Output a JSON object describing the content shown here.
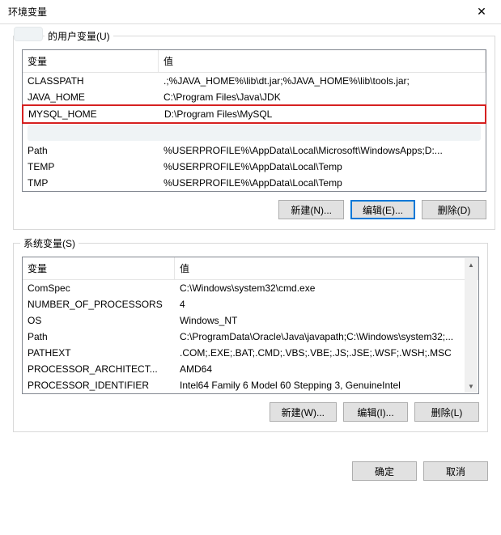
{
  "window": {
    "title": "环境变量",
    "close_icon": "✕"
  },
  "user_section": {
    "label_suffix": "的用户变量(U)",
    "headers": {
      "variable": "变量",
      "value": "值"
    },
    "rows": [
      {
        "var": "CLASSPATH",
        "val": ".;%JAVA_HOME%\\lib\\dt.jar;%JAVA_HOME%\\lib\\tools.jar;"
      },
      {
        "var": "JAVA_HOME",
        "val": "C:\\Program Files\\Java\\JDK"
      },
      {
        "var": "MYSQL_HOME",
        "val": "D:\\Program Files\\MySQL"
      },
      {
        "var": "Path",
        "val": "%USERPROFILE%\\AppData\\Local\\Microsoft\\WindowsApps;D:..."
      },
      {
        "var": "TEMP",
        "val": "%USERPROFILE%\\AppData\\Local\\Temp"
      },
      {
        "var": "TMP",
        "val": "%USERPROFILE%\\AppData\\Local\\Temp"
      }
    ],
    "buttons": {
      "new": "新建(N)...",
      "edit": "编辑(E)...",
      "delete": "删除(D)"
    }
  },
  "system_section": {
    "label": "系统变量(S)",
    "headers": {
      "variable": "变量",
      "value": "值"
    },
    "rows": [
      {
        "var": "ComSpec",
        "val": "C:\\Windows\\system32\\cmd.exe"
      },
      {
        "var": "NUMBER_OF_PROCESSORS",
        "val": "4"
      },
      {
        "var": "OS",
        "val": "Windows_NT"
      },
      {
        "var": "Path",
        "val": "C:\\ProgramData\\Oracle\\Java\\javapath;C:\\Windows\\system32;..."
      },
      {
        "var": "PATHEXT",
        "val": ".COM;.EXE;.BAT;.CMD;.VBS;.VBE;.JS;.JSE;.WSF;.WSH;.MSC"
      },
      {
        "var": "PROCESSOR_ARCHITECT...",
        "val": "AMD64"
      },
      {
        "var": "PROCESSOR_IDENTIFIER",
        "val": "Intel64 Family 6 Model 60 Stepping 3, GenuineIntel"
      }
    ],
    "buttons": {
      "new": "新建(W)...",
      "edit": "编辑(I)...",
      "delete": "删除(L)"
    }
  },
  "footer": {
    "ok": "确定",
    "cancel": "取消"
  },
  "scroll": {
    "up": "▲",
    "down": "▼"
  }
}
